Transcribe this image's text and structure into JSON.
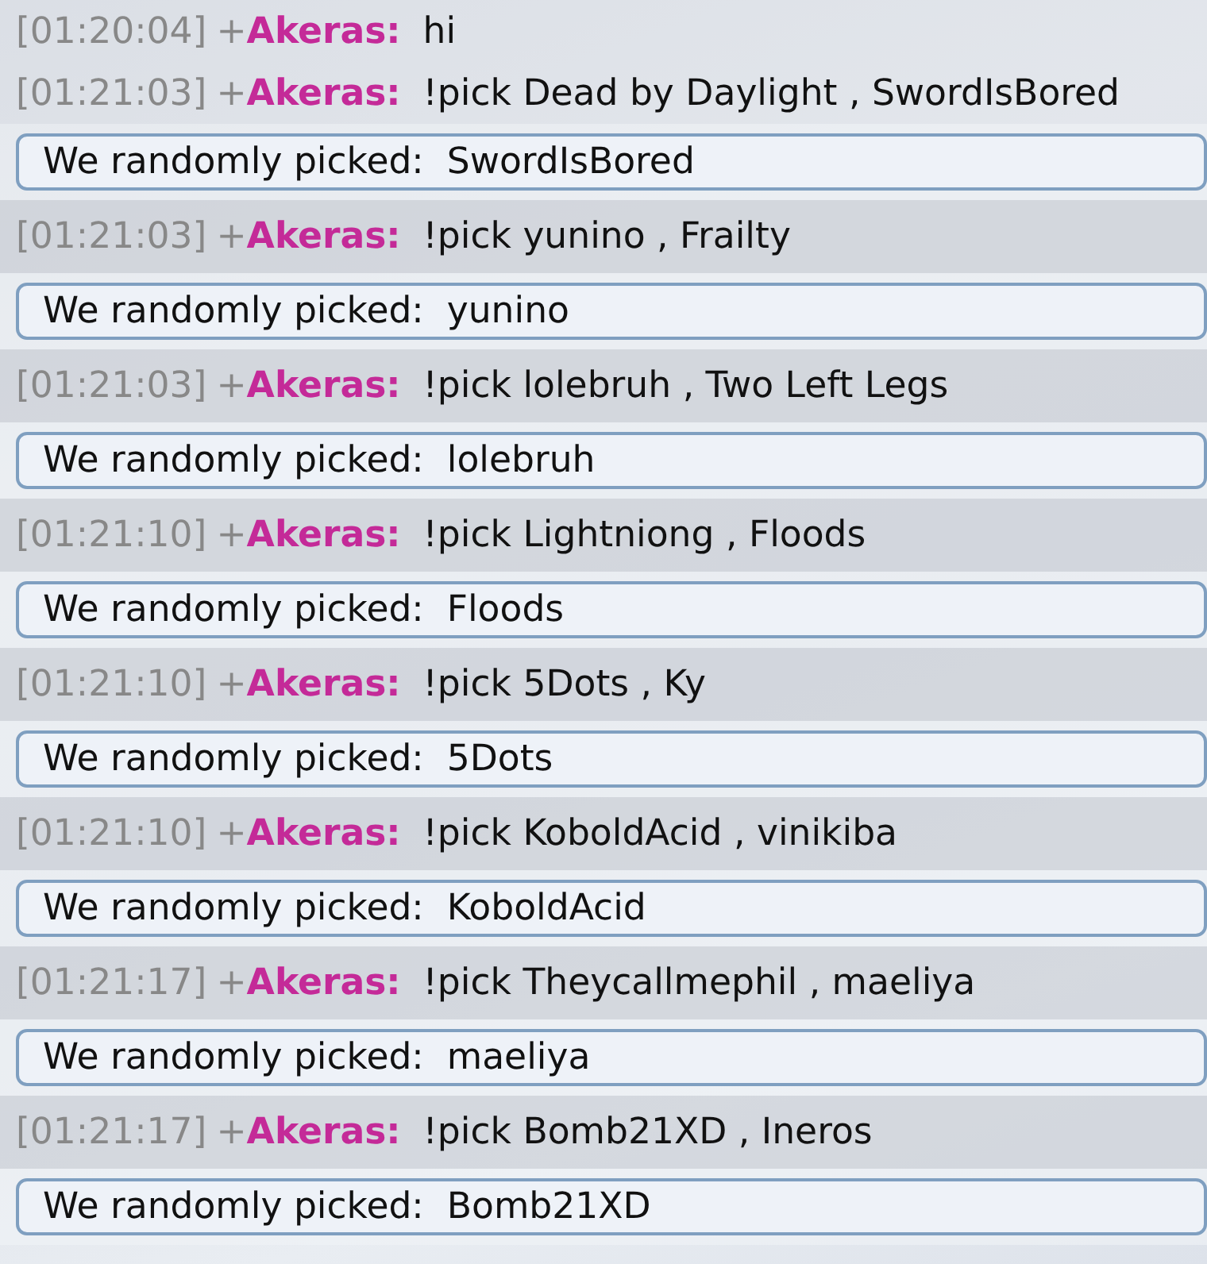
{
  "messages": [
    {
      "kind": "chat",
      "shaded": false,
      "time": "[01:20:04]",
      "badge": "+",
      "user": "Akeras:",
      "text": "hi"
    },
    {
      "kind": "chat",
      "shaded": false,
      "time": "[01:21:03]",
      "badge": "+",
      "user": "Akeras:",
      "text": "!pick Dead by Daylight , SwordIsBored"
    },
    {
      "kind": "bot",
      "text": "We randomly picked:  SwordIsBored"
    },
    {
      "kind": "chat",
      "shaded": true,
      "time": "[01:21:03]",
      "badge": "+",
      "user": "Akeras:",
      "text": "!pick yunino , Frailty"
    },
    {
      "kind": "bot",
      "text": "We randomly picked:  yunino"
    },
    {
      "kind": "chat",
      "shaded": true,
      "time": "[01:21:03]",
      "badge": "+",
      "user": "Akeras:",
      "text": "!pick lolebruh , Two Left Legs"
    },
    {
      "kind": "bot",
      "text": "We randomly picked:  lolebruh"
    },
    {
      "kind": "chat",
      "shaded": true,
      "time": "[01:21:10]",
      "badge": "+",
      "user": "Akeras:",
      "text": "!pick Lightniong , Floods"
    },
    {
      "kind": "bot",
      "text": "We randomly picked:  Floods"
    },
    {
      "kind": "chat",
      "shaded": true,
      "time": "[01:21:10]",
      "badge": "+",
      "user": "Akeras:",
      "text": "!pick 5Dots , Ky"
    },
    {
      "kind": "bot",
      "text": "We randomly picked:  5Dots"
    },
    {
      "kind": "chat",
      "shaded": true,
      "time": "[01:21:10]",
      "badge": "+",
      "user": "Akeras:",
      "text": "!pick KoboldAcid , vinikiba"
    },
    {
      "kind": "bot",
      "text": "We randomly picked:  KoboldAcid"
    },
    {
      "kind": "chat",
      "shaded": true,
      "time": "[01:21:17]",
      "badge": "+",
      "user": "Akeras:",
      "text": "!pick Theycallmephil , maeliya"
    },
    {
      "kind": "bot",
      "text": "We randomly picked:  maeliya"
    },
    {
      "kind": "chat",
      "shaded": true,
      "time": "[01:21:17]",
      "badge": "+",
      "user": "Akeras:",
      "text": "!pick Bomb21XD , Ineros"
    },
    {
      "kind": "bot",
      "text": "We randomly picked:  Bomb21XD"
    }
  ]
}
